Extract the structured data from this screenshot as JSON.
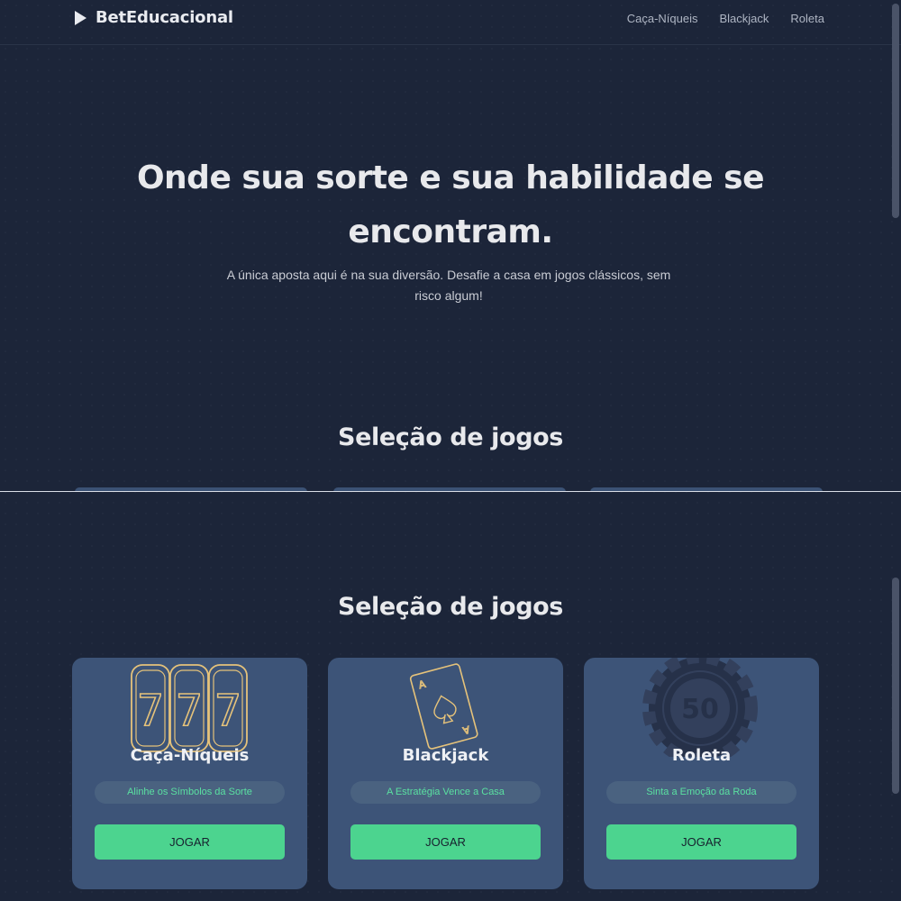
{
  "header": {
    "logo_text": "BetEducacional",
    "nav": [
      {
        "label": "Caça-Níqueis"
      },
      {
        "label": "Blackjack"
      },
      {
        "label": "Roleta"
      }
    ]
  },
  "hero": {
    "title": "Onde sua sorte e sua habilidade se encontram.",
    "subtitle": "A única aposta aqui é na sua diversão. Desafie a casa em jogos clássicos, sem risco algum!"
  },
  "games_section": {
    "title": "Seleção de jogos",
    "cards": [
      {
        "title": "Caça-Níqueis",
        "tagline": "Alinhe os Símbolos da Sorte",
        "button": "JOGAR",
        "icon": "slot-777-icon",
        "reels": [
          "7",
          "7",
          "7"
        ]
      },
      {
        "title": "Blackjack",
        "tagline": "A Estratégia Vence a Casa",
        "button": "JOGAR",
        "icon": "playing-card-icon",
        "card_rank": "A"
      },
      {
        "title": "Roleta",
        "tagline": "Sinta a Emoção da Roda",
        "button": "JOGAR",
        "icon": "poker-chip-icon",
        "chip_value": "50"
      }
    ]
  },
  "colors": {
    "background": "#1c2539",
    "card": "#3d5478",
    "accent_green": "#4cd48f",
    "gold": "#e5c27a"
  }
}
